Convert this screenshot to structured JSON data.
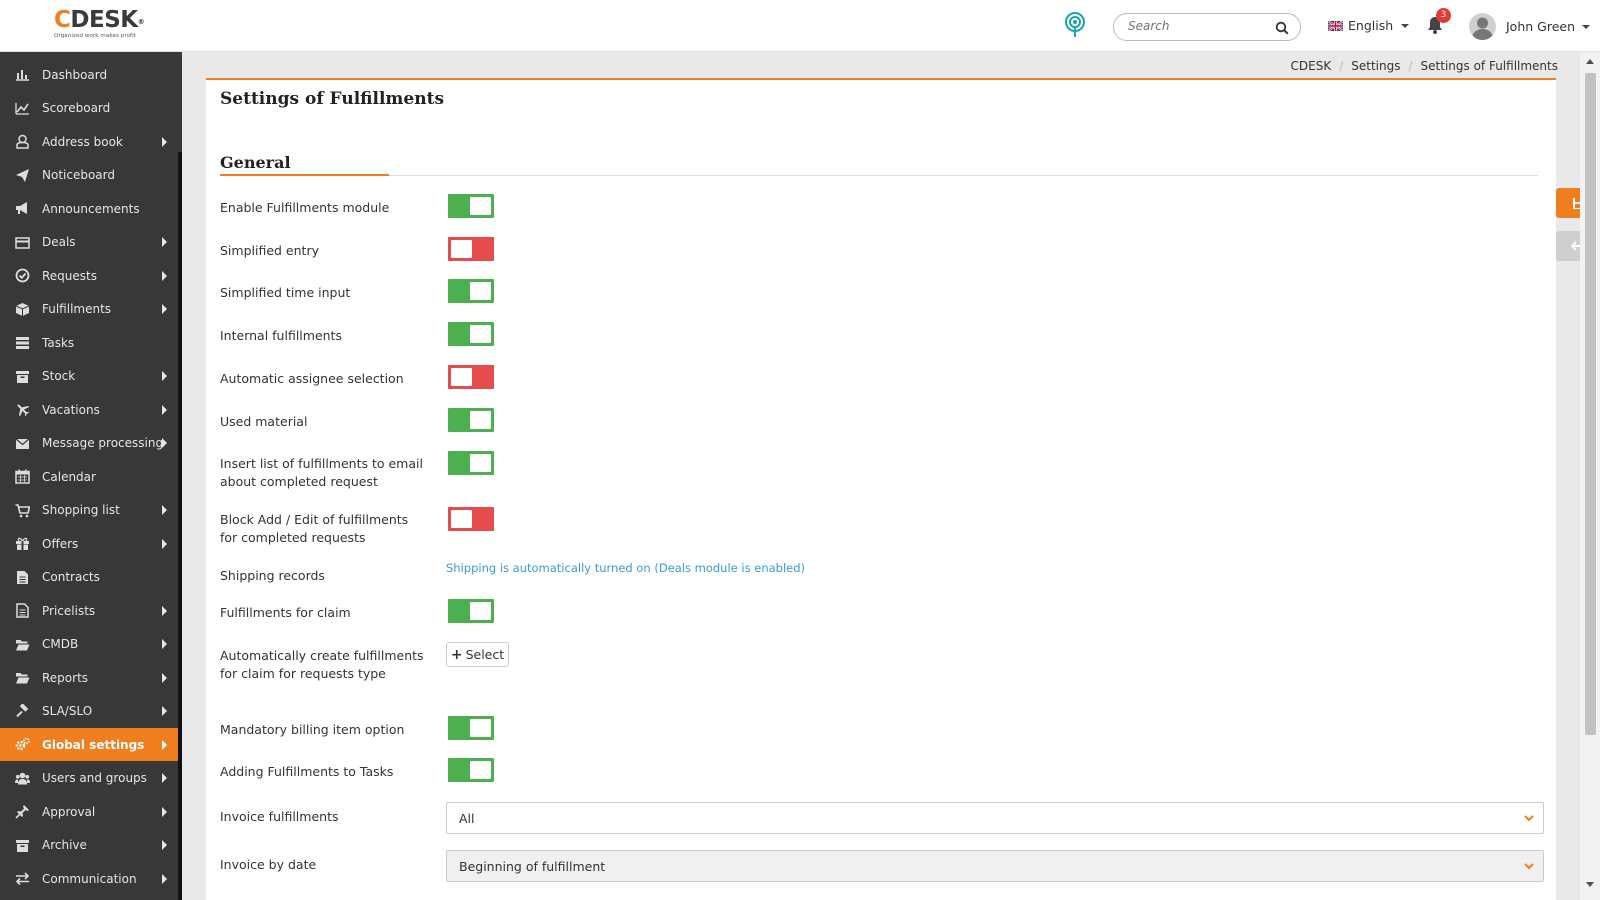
{
  "header": {
    "logo_text": "CDESK",
    "logo_mark": "®",
    "logo_tagline": "Organized work makes profit",
    "search_placeholder": "Search",
    "language": "English",
    "notification_count": "3",
    "user_name": "John Green"
  },
  "sidebar": {
    "items": [
      {
        "label": "Dashboard",
        "icon": "chart-bar-icon",
        "has_submenu": false
      },
      {
        "label": "Scoreboard",
        "icon": "line-chart-icon",
        "has_submenu": false
      },
      {
        "label": "Address book",
        "icon": "user-icon",
        "has_submenu": true
      },
      {
        "label": "Noticeboard",
        "icon": "paper-plane-icon",
        "has_submenu": false
      },
      {
        "label": "Announcements",
        "icon": "bullhorn-icon",
        "has_submenu": false
      },
      {
        "label": "Deals",
        "icon": "credit-card-icon",
        "has_submenu": true
      },
      {
        "label": "Requests",
        "icon": "check-circle-icon",
        "has_submenu": true
      },
      {
        "label": "Fulfillments",
        "icon": "cube-icon",
        "has_submenu": true
      },
      {
        "label": "Tasks",
        "icon": "tasks-icon",
        "has_submenu": false
      },
      {
        "label": "Stock",
        "icon": "archive-box-icon",
        "has_submenu": true
      },
      {
        "label": "Vacations",
        "icon": "plane-icon",
        "has_submenu": true
      },
      {
        "label": "Message processing",
        "icon": "envelope-icon",
        "has_submenu": true
      },
      {
        "label": "Calendar",
        "icon": "calendar-icon",
        "has_submenu": false
      },
      {
        "label": "Shopping list",
        "icon": "cart-icon",
        "has_submenu": true
      },
      {
        "label": "Offers",
        "icon": "gift-icon",
        "has_submenu": true
      },
      {
        "label": "Contracts",
        "icon": "file-icon",
        "has_submenu": false
      },
      {
        "label": "Pricelists",
        "icon": "file-text-icon",
        "has_submenu": true
      },
      {
        "label": "CMDB",
        "icon": "folder-open-icon",
        "has_submenu": true
      },
      {
        "label": "Reports",
        "icon": "folder-open-icon",
        "has_submenu": true
      },
      {
        "label": "SLA/SLO",
        "icon": "gavel-icon",
        "has_submenu": true
      },
      {
        "label": "Global settings",
        "icon": "cogs-icon",
        "has_submenu": true,
        "active": true
      },
      {
        "label": "Users and groups",
        "icon": "users-icon",
        "has_submenu": true
      },
      {
        "label": "Approval",
        "icon": "thumbtack-icon",
        "has_submenu": true
      },
      {
        "label": "Archive",
        "icon": "archive-box-icon",
        "has_submenu": true
      },
      {
        "label": "Communication",
        "icon": "exchange-icon",
        "has_submenu": true
      }
    ]
  },
  "breadcrumb": [
    "CDESK",
    "Settings",
    "Settings of Fulfillments"
  ],
  "page": {
    "title": "Settings of Fulfillments",
    "section_title": "General"
  },
  "settings": {
    "enable_module": {
      "label": "Enable Fulfillments module",
      "on": true
    },
    "simplified_entry": {
      "label": "Simplified entry",
      "on": false
    },
    "simplified_time": {
      "label": "Simplified time input",
      "on": true
    },
    "internal": {
      "label": "Internal fulfillments",
      "on": true
    },
    "auto_assignee": {
      "label": "Automatic assignee selection",
      "on": false
    },
    "used_material": {
      "label": "Used material",
      "on": true
    },
    "insert_list": {
      "label": "Insert list of fulfillments to email about completed request",
      "on": true
    },
    "block_edit": {
      "label": "Block Add / Edit of fulfillments for completed requests",
      "on": false
    },
    "shipping": {
      "label": "Shipping records",
      "info": "Shipping is automatically turned on (Deals module is enabled)"
    },
    "for_claim": {
      "label": "Fulfillments for claim",
      "on": true
    },
    "auto_create_claim": {
      "label": "Automatically create fulfillments for claim for requests type",
      "button": "Select"
    },
    "mandatory_billing": {
      "label": "Mandatory billing item option",
      "on": true
    },
    "add_to_tasks": {
      "label": "Adding Fulfillments to Tasks",
      "on": true
    },
    "invoice_fulfillments": {
      "label": "Invoice fulfillments",
      "value": "All"
    },
    "invoice_by_date": {
      "label": "Invoice by date",
      "value": "Beginning of fulfillment"
    }
  },
  "colors": {
    "accent": "#f07e1e",
    "toggle_on": "#4caf50",
    "toggle_off": "#e74c4c",
    "sidebar_bg": "#383838",
    "info_text": "#3a9ad9"
  }
}
